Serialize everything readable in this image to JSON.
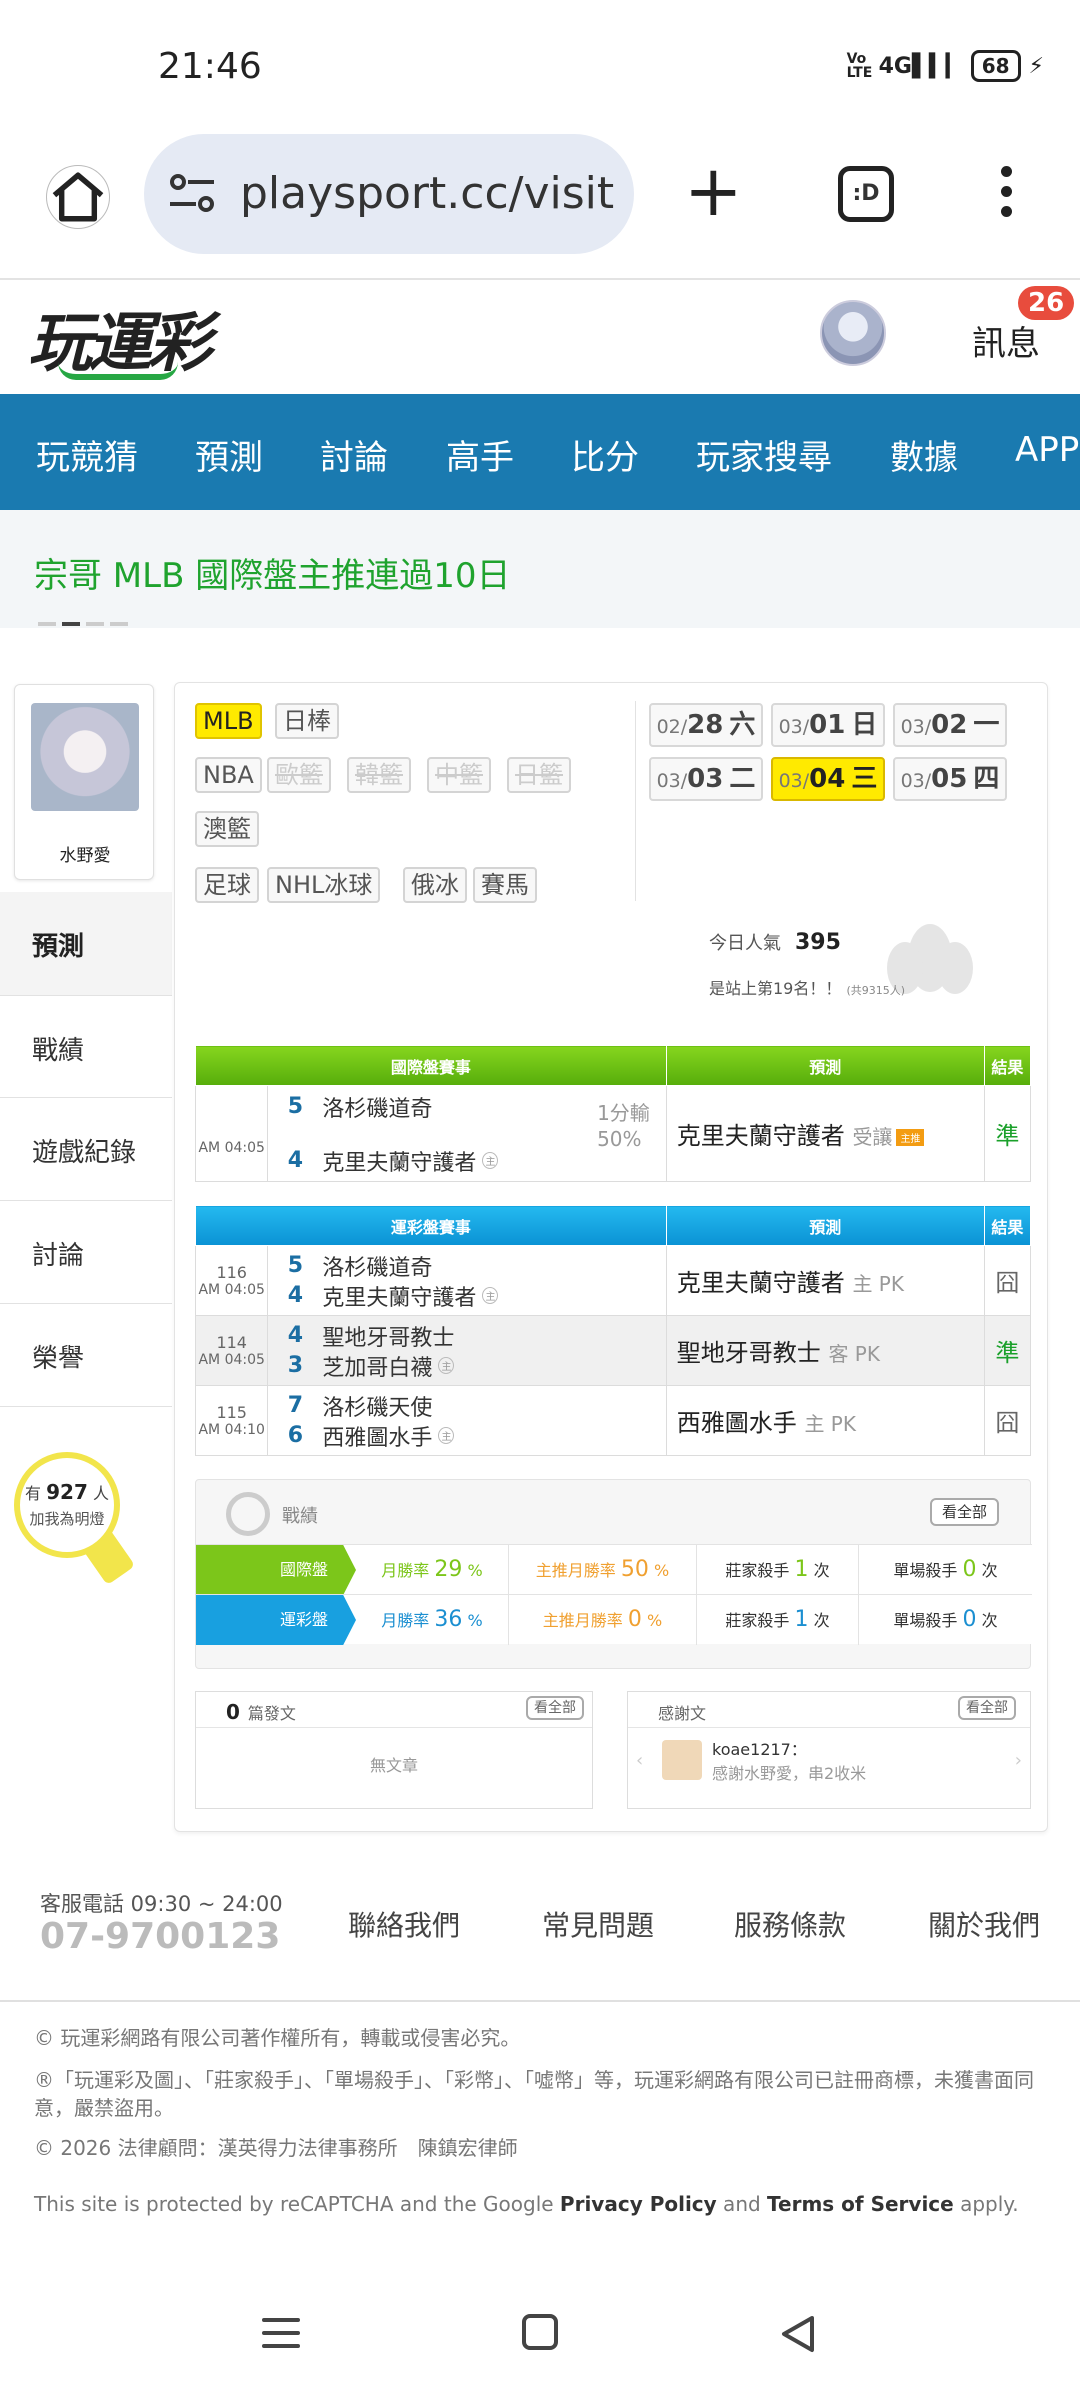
{
  "status": {
    "time": "21:46",
    "volte": "Vo LTE",
    "net": "4G",
    "battery": "68"
  },
  "browser": {
    "url": "playsport.cc/visit",
    "tabs_label": ":D"
  },
  "site": {
    "logo": "玩運彩",
    "messages_label": "訊息",
    "messages_count": "26"
  },
  "nav": [
    "玩競猜",
    "預測",
    "討論",
    "高手",
    "比分",
    "玩家搜尋",
    "數據",
    "APP"
  ],
  "marquee": {
    "text": "宗哥  MLB 國際盤主推連過10日"
  },
  "profile": {
    "name": "水野愛"
  },
  "side_menu": [
    "預測",
    "戰績",
    "遊戲紀錄",
    "討論",
    "榮譽"
  ],
  "fans": {
    "prefix": "有",
    "count": "927",
    "suffix": "人",
    "sub": "加我為明燈"
  },
  "sports": {
    "row1": [
      "MLB",
      "日棒"
    ],
    "row2": [
      "NBA",
      "歐籃",
      "韓籃",
      "中籃",
      "日籃"
    ],
    "row3": [
      "澳籃"
    ],
    "row4": [
      "足球",
      "NHL冰球",
      "俄冰",
      "賽馬"
    ]
  },
  "dates": [
    {
      "md": "02/",
      "d": "28",
      "w": "六"
    },
    {
      "md": "03/",
      "d": "01",
      "w": "日"
    },
    {
      "md": "03/",
      "d": "02",
      "w": "一"
    },
    {
      "md": "03/",
      "d": "03",
      "w": "二"
    },
    {
      "md": "03/",
      "d": "04",
      "w": "三"
    },
    {
      "md": "03/",
      "d": "05",
      "w": "四"
    }
  ],
  "popularity": {
    "label": "今日人氣",
    "value": "395",
    "rank": "是站上第19名！！",
    "total": "(共9315人)"
  },
  "intl": {
    "headers": [
      "國際盤賽事",
      "預測",
      "結果"
    ],
    "rows": [
      {
        "time": "AM 04:05",
        "away_score": "5",
        "away": "洛杉磯道奇",
        "home_score": "4",
        "home": "克里夫蘭守護者",
        "home_mark": "主",
        "odds1": "1分輸",
        "odds2": "50%",
        "pick": "克里夫蘭守護者",
        "pick_type": "受讓",
        "hot": "主推",
        "result": "準"
      }
    ]
  },
  "lottery": {
    "headers": [
      "運彩盤賽事",
      "預測",
      "結果"
    ],
    "rows": [
      {
        "num": "116",
        "time": "AM 04:05",
        "away_score": "5",
        "away": "洛杉磯道奇",
        "home_score": "4",
        "home": "克里夫蘭守護者",
        "home_mark": "主",
        "pick": "克里夫蘭守護者",
        "pick_type": "主 PK",
        "result": "囧"
      },
      {
        "num": "114",
        "time": "AM 04:05",
        "away_score": "4",
        "away": "聖地牙哥教士",
        "home_score": "3",
        "home": "芝加哥白襪",
        "home_mark": "主",
        "pick": "聖地牙哥教士",
        "pick_type": "客 PK",
        "result": "準"
      },
      {
        "num": "115",
        "time": "AM 04:10",
        "away_score": "7",
        "away": "洛杉磯天使",
        "home_score": "6",
        "home": "西雅圖水手",
        "home_mark": "主",
        "pick": "西雅圖水手",
        "pick_type": "主 PK",
        "result": "囧"
      }
    ]
  },
  "stats": {
    "title": "戰績",
    "all_label": "看全部",
    "rows": [
      {
        "label": "國際盤",
        "month_label": "月勝率",
        "month": "29",
        "main_label": "主推月勝率",
        "main": "50",
        "bank_label": "莊家殺手",
        "bank": "1",
        "single_label": "單場殺手",
        "single": "0",
        "unit_pct": "%",
        "unit_times": "次"
      },
      {
        "label": "運彩盤",
        "month_label": "月勝率",
        "month": "36",
        "main_label": "主推月勝率",
        "main": "0",
        "bank_label": "莊家殺手",
        "bank": "1",
        "single_label": "單場殺手",
        "single": "0",
        "unit_pct": "%",
        "unit_times": "次"
      }
    ]
  },
  "posts": {
    "count": "0",
    "label": "篇發文",
    "all_label": "看全部",
    "empty": "無文章"
  },
  "thanks": {
    "label": "感謝文",
    "all_label": "看全部",
    "user": "koae1217：",
    "msg": "感謝水野愛，串2收米"
  },
  "footer": {
    "service": "客服電話 09:30 ~ 24:00",
    "phone": "07-9700123",
    "links": [
      "聯絡我們",
      "常見問題",
      "服務條款",
      "關於我們"
    ],
    "copyright": "© 玩運彩網路有限公司著作權所有，轉載或侵害必究。",
    "trademark": "®「玩運彩及圖」、「莊家殺手」、「單場殺手」、「彩幣」、「噓幣」等，玩運彩網路有限公司已註冊商標，未獲書面同意，嚴禁盜用。",
    "legal": "© 2026 法律顧問：漢英得力法律事務所　陳鎮宏律師",
    "recaptcha_pre": "This site is protected by reCAPTCHA and the Google ",
    "privacy": "Privacy Policy",
    "and": " and ",
    "terms": "Terms of Service",
    "apply": " apply."
  },
  "colors": {
    "nav": "#1a7ab0",
    "accent_green": "#1fa32e",
    "intl_header": "#66bb10",
    "lottery_header": "#0fa2e0",
    "selected": "#ffea00"
  }
}
